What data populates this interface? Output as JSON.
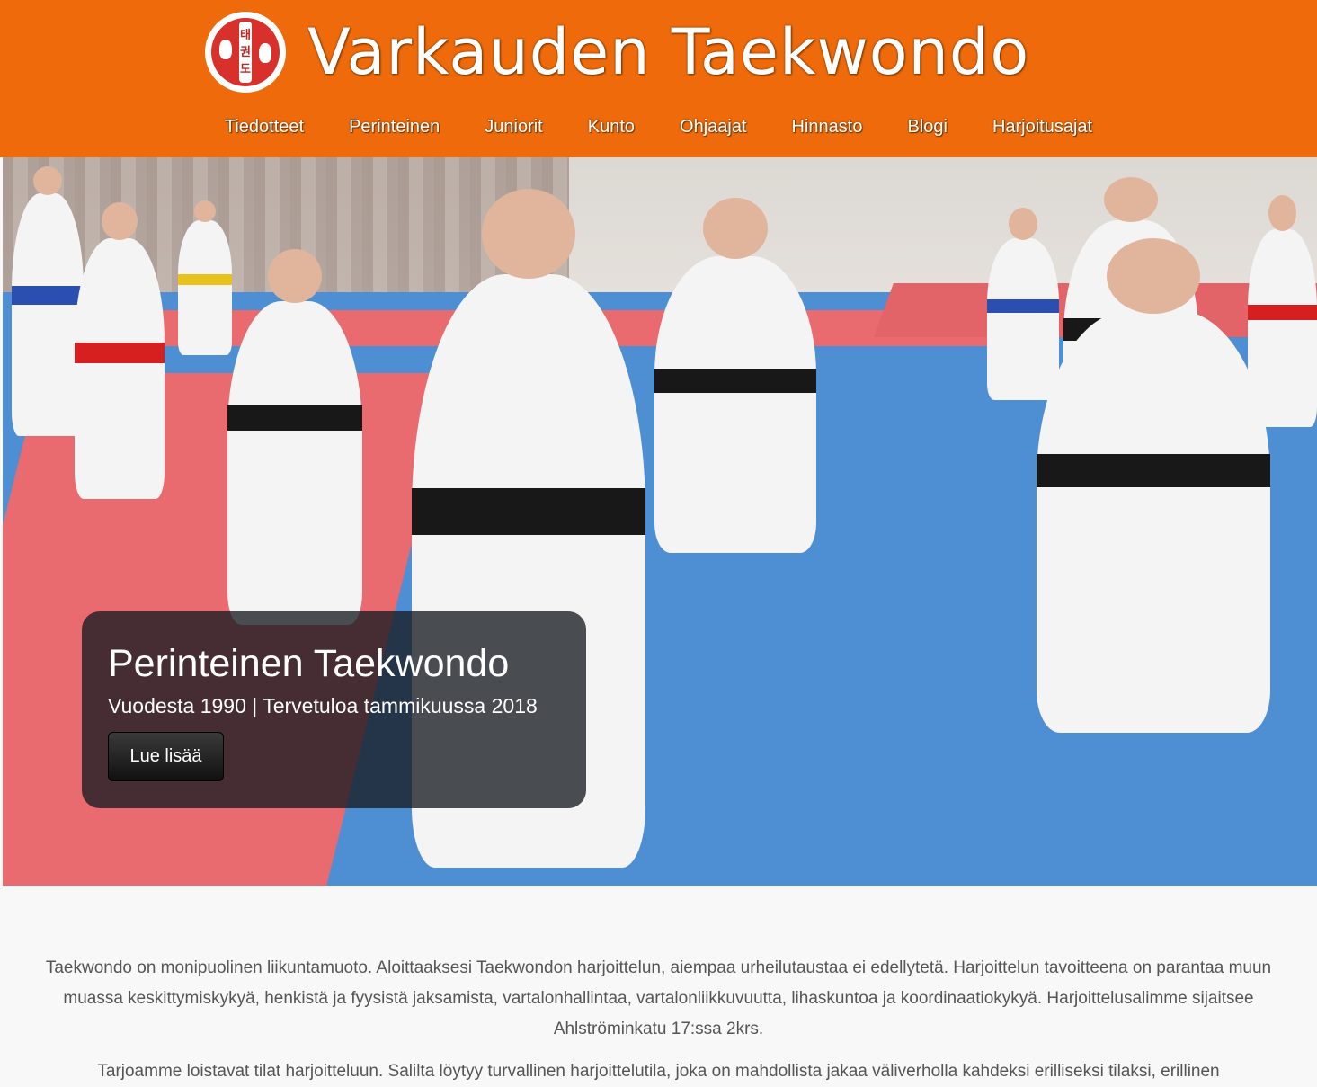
{
  "header": {
    "title": "Varkauden Taekwondo",
    "logo_chars": [
      "태",
      "권",
      "도"
    ],
    "color": "#ee6a0a"
  },
  "nav": {
    "items": [
      "Tiedotteet",
      "Perinteinen",
      "Juniorit",
      "Kunto",
      "Ohjaajat",
      "Hinnasto",
      "Blogi",
      "Harjoitusajat"
    ]
  },
  "hero": {
    "title": "Perinteinen Taekwondo",
    "subtitle": "Vuodesta 1990 | Tervetuloa tammikuussa 2018",
    "button_label": "Lue lisää"
  },
  "content": {
    "paragraphs": [
      "Taekwondo on monipuolinen liikuntamuoto. Aloittaaksesi Taekwondon harjoittelun, aiempaa urheilutaustaa ei edellytetä. Harjoittelun tavoitteena on parantaa muun muassa keskittymiskykyä, henkistä ja fyysistä jaksamista, vartalonhallintaa, vartalonliikkuvuutta, lihaskuntoa ja koordinaatiokykyä. Harjoittelusalimme sijaitsee Ahlströminkatu 17:ssa 2krs.",
      "Tarjoamme loistavat tilat harjoitteluun. Salilta löytyy turvallinen harjoittelutila, joka on mahdollista jakaa väliverholla kahdeksi erilliseksi tilaksi, erillinen"
    ]
  }
}
